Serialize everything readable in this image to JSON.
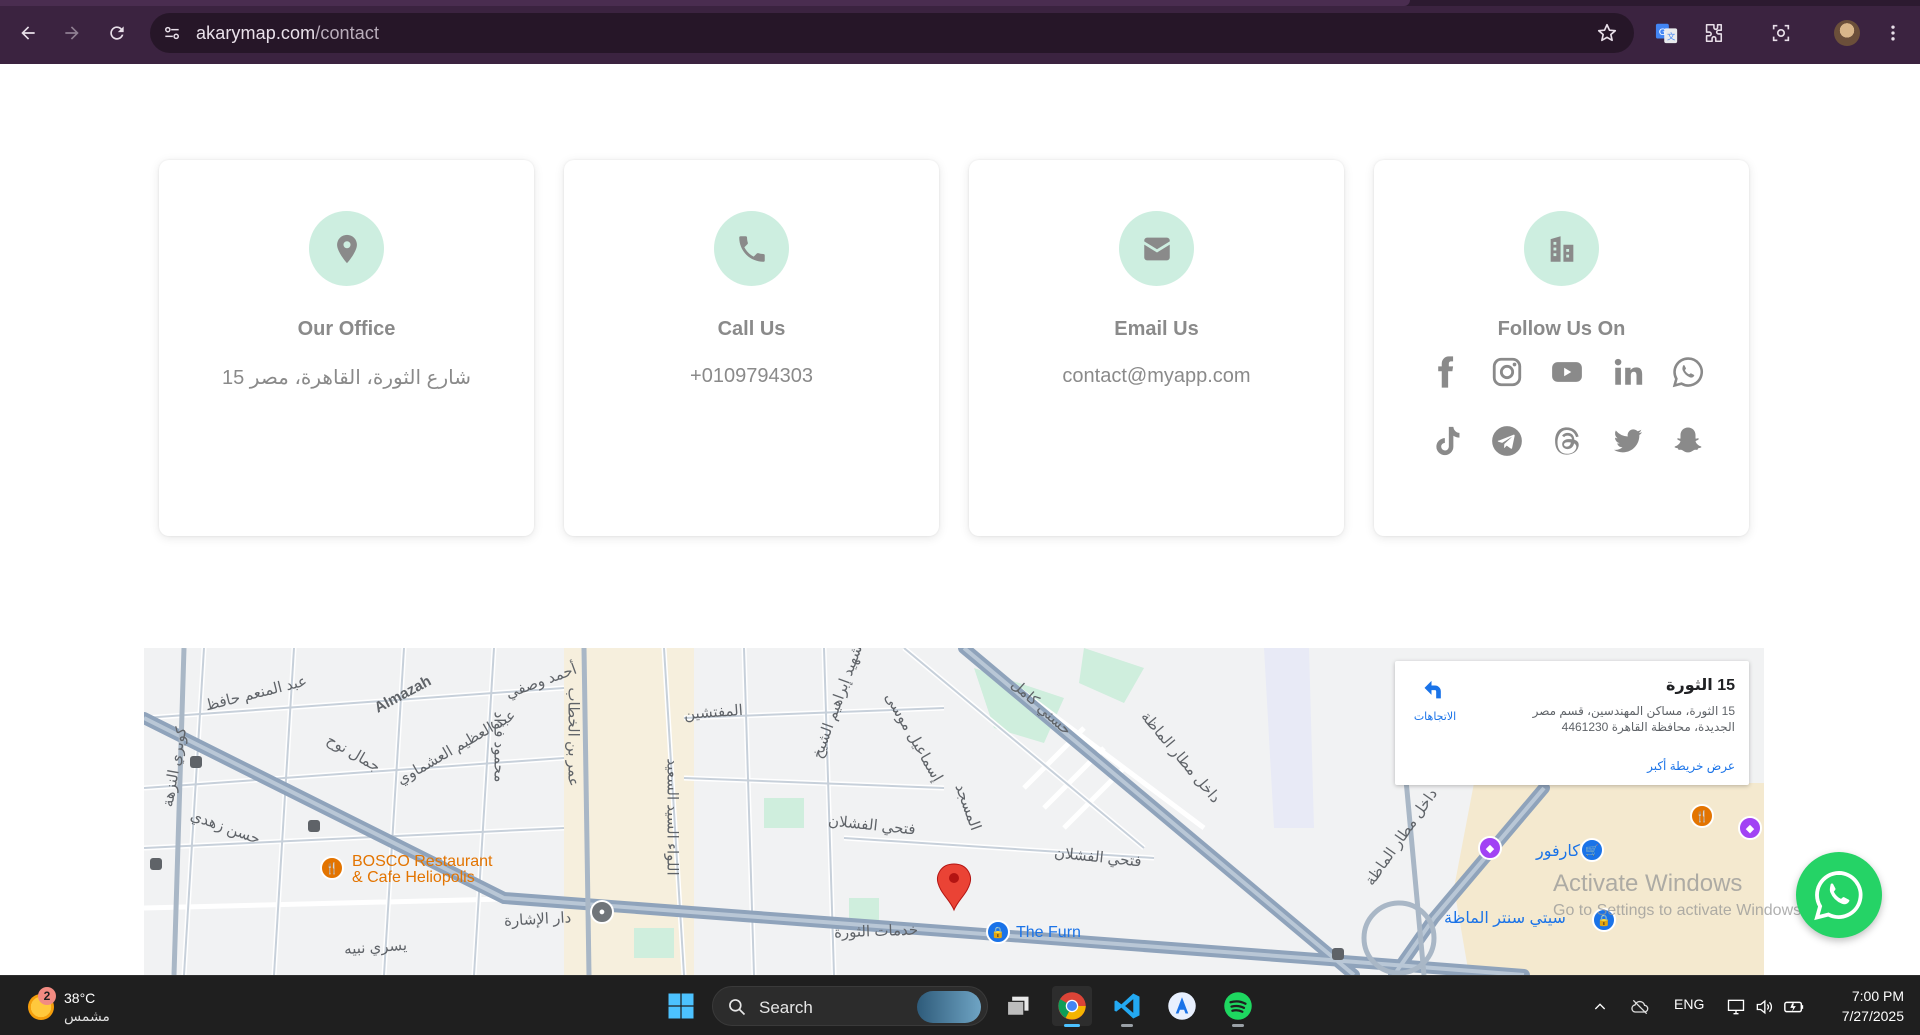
{
  "browser": {
    "url_host": "akarymap.com",
    "url_path": "/contact",
    "icons": [
      "back-icon",
      "forward-icon",
      "reload-icon",
      "site-info-icon",
      "star-icon",
      "translate-icon",
      "extensions-icon",
      "screenshot-icon",
      "profile-avatar",
      "menu-icon"
    ]
  },
  "cards": [
    {
      "id": "office",
      "title": "Our Office",
      "value": "شارع الثورة، القاهرة، مصر 15",
      "icon": "location-pin-icon"
    },
    {
      "id": "call",
      "title": "Call Us",
      "value": "+0109794303",
      "icon": "phone-icon"
    },
    {
      "id": "email",
      "title": "Email Us",
      "value": "contact@myapp.com",
      "icon": "envelope-icon"
    },
    {
      "id": "follow",
      "title": "Follow Us On",
      "icon": "building-icon",
      "social_row1": [
        "facebook-icon",
        "instagram-icon",
        "youtube-icon",
        "linkedin-icon",
        "whatsapp-icon"
      ],
      "social_row2": [
        "tiktok-icon",
        "telegram-icon",
        "threads-icon",
        "twitter-icon",
        "snapchat-icon"
      ]
    }
  ],
  "colors": {
    "badge_bg": "#cdeee0",
    "icon_gray": "#8a8a8a",
    "chrome_bg": "#3b2340",
    "whatsapp": "#25d366"
  },
  "map": {
    "infobox": {
      "title": "15 الثورة",
      "address": "15 الثورة، مساكن المهندسين، قسم مصر الجديدة، محافظة القاهرة 4461230",
      "larger_map_link": "عرض خريطة أكبر",
      "directions_label": "الاتجاهات"
    },
    "labels": {
      "almazah": "Almazah",
      "bosco_line1": "BOSCO Restaurant",
      "bosco_line2": "& Cafe Heliopolis",
      "the_furn": "The Furn",
      "dar_al_ishara": "دار الإشارة",
      "khadamat_althawra": "خدمات الثورة",
      "fathi_alfishlan": "فتحي الفشلان",
      "fathi_alfishlan2": "فتحي الفشلان",
      "al_mufattishin": "المفتشين",
      "ahmed_wasfi": "أحمد وصفي",
      "abdelmonem_hafez": "عبد المنعم حافظ",
      "abdelazim": "عبد العظيم العشماوي",
      "hassan_zohdi": "حسن زهدي",
      "hosni_kamel": "حسني كامل",
      "dakhel_matar1": "داخل مطار الماظة",
      "dakhel_matar2": "داخل مطار الماظة",
      "carrefour": "كارفور",
      "city_center": "سيتي سنتر الماظة",
      "ismail_moussa": "إسماعيل موسى",
      "al_masjid": "المسجد",
      "yousri_nabih": "يسري نبيه",
      "kobry_alnozha": "كوبري النزهة",
      "omar_bin_alkhattab": "عمر بن الخطاب",
      "mahmoud_fouad": "محمود فؤاد",
      "gamal_nouh": "جمال نوح",
      "alliwa": "اللواء السيد السعيد",
      "alshahid": "الشهيد إبراهيم الشيخ"
    }
  },
  "overlay": {
    "activate_title": "Activate Windows",
    "activate_sub": "Go to Settings to activate Windows."
  },
  "taskbar": {
    "weather_temp": "38°C",
    "weather_cond": "مشمس",
    "weather_badge": "2",
    "search_label": "Search",
    "lang": "ENG",
    "time": "7:00 PM",
    "date": "7/27/2025",
    "apps": [
      "windows-start-icon",
      "task-view-icon",
      "chrome-icon",
      "vscode-icon",
      "app-a-icon",
      "spotify-icon"
    ]
  }
}
